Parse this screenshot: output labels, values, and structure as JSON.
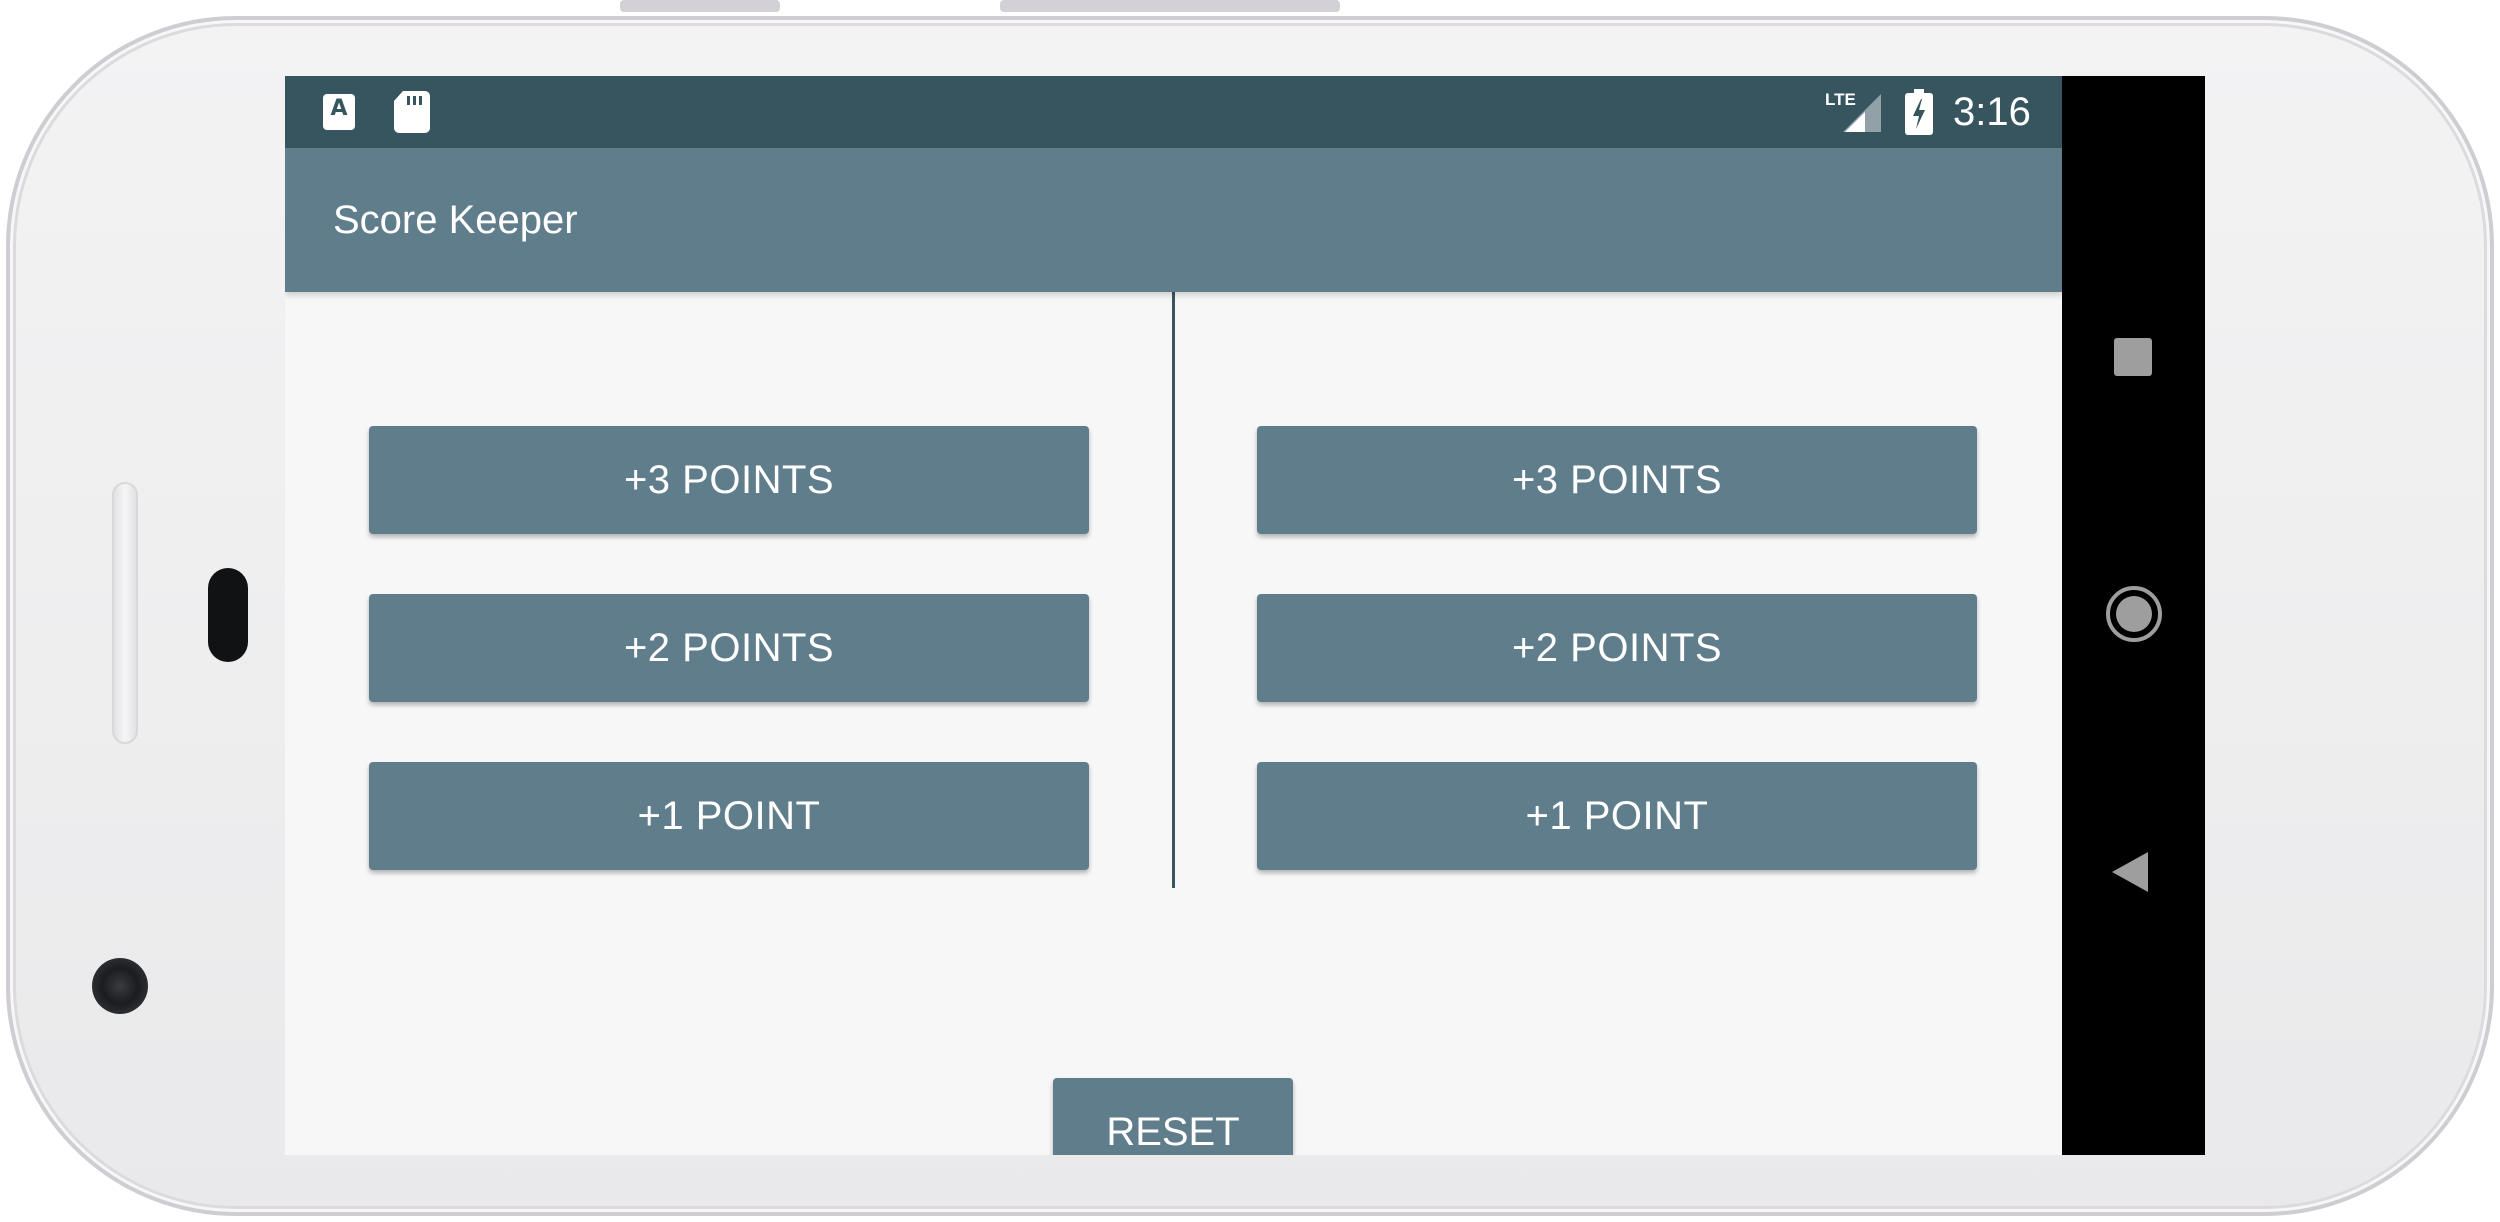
{
  "status_bar": {
    "time": "3:16",
    "notification_icons": [
      "a-notification-icon",
      "sd-card-icon"
    ],
    "system_icons": [
      "lte-signal-icon",
      "battery-charging-icon"
    ],
    "network_label": "LTE",
    "a_icon_glyph": "A"
  },
  "app_bar": {
    "title": "Score Keeper"
  },
  "team_a": {
    "plus3_label": "+3 POINTS",
    "plus2_label": "+2 POINTS",
    "plus1_label": "+1 POINT"
  },
  "team_b": {
    "plus3_label": "+3 POINTS",
    "plus2_label": "+2 POINTS",
    "plus1_label": "+1 POINT"
  },
  "reset": {
    "label": "RESET"
  },
  "nav_bar": {
    "icons": [
      "recent-apps-icon",
      "home-icon",
      "back-icon"
    ]
  },
  "colors": {
    "status_bar": "#37555f",
    "primary": "#607d8b",
    "background": "#f7f7f8",
    "text_on_primary": "#ffffff"
  }
}
